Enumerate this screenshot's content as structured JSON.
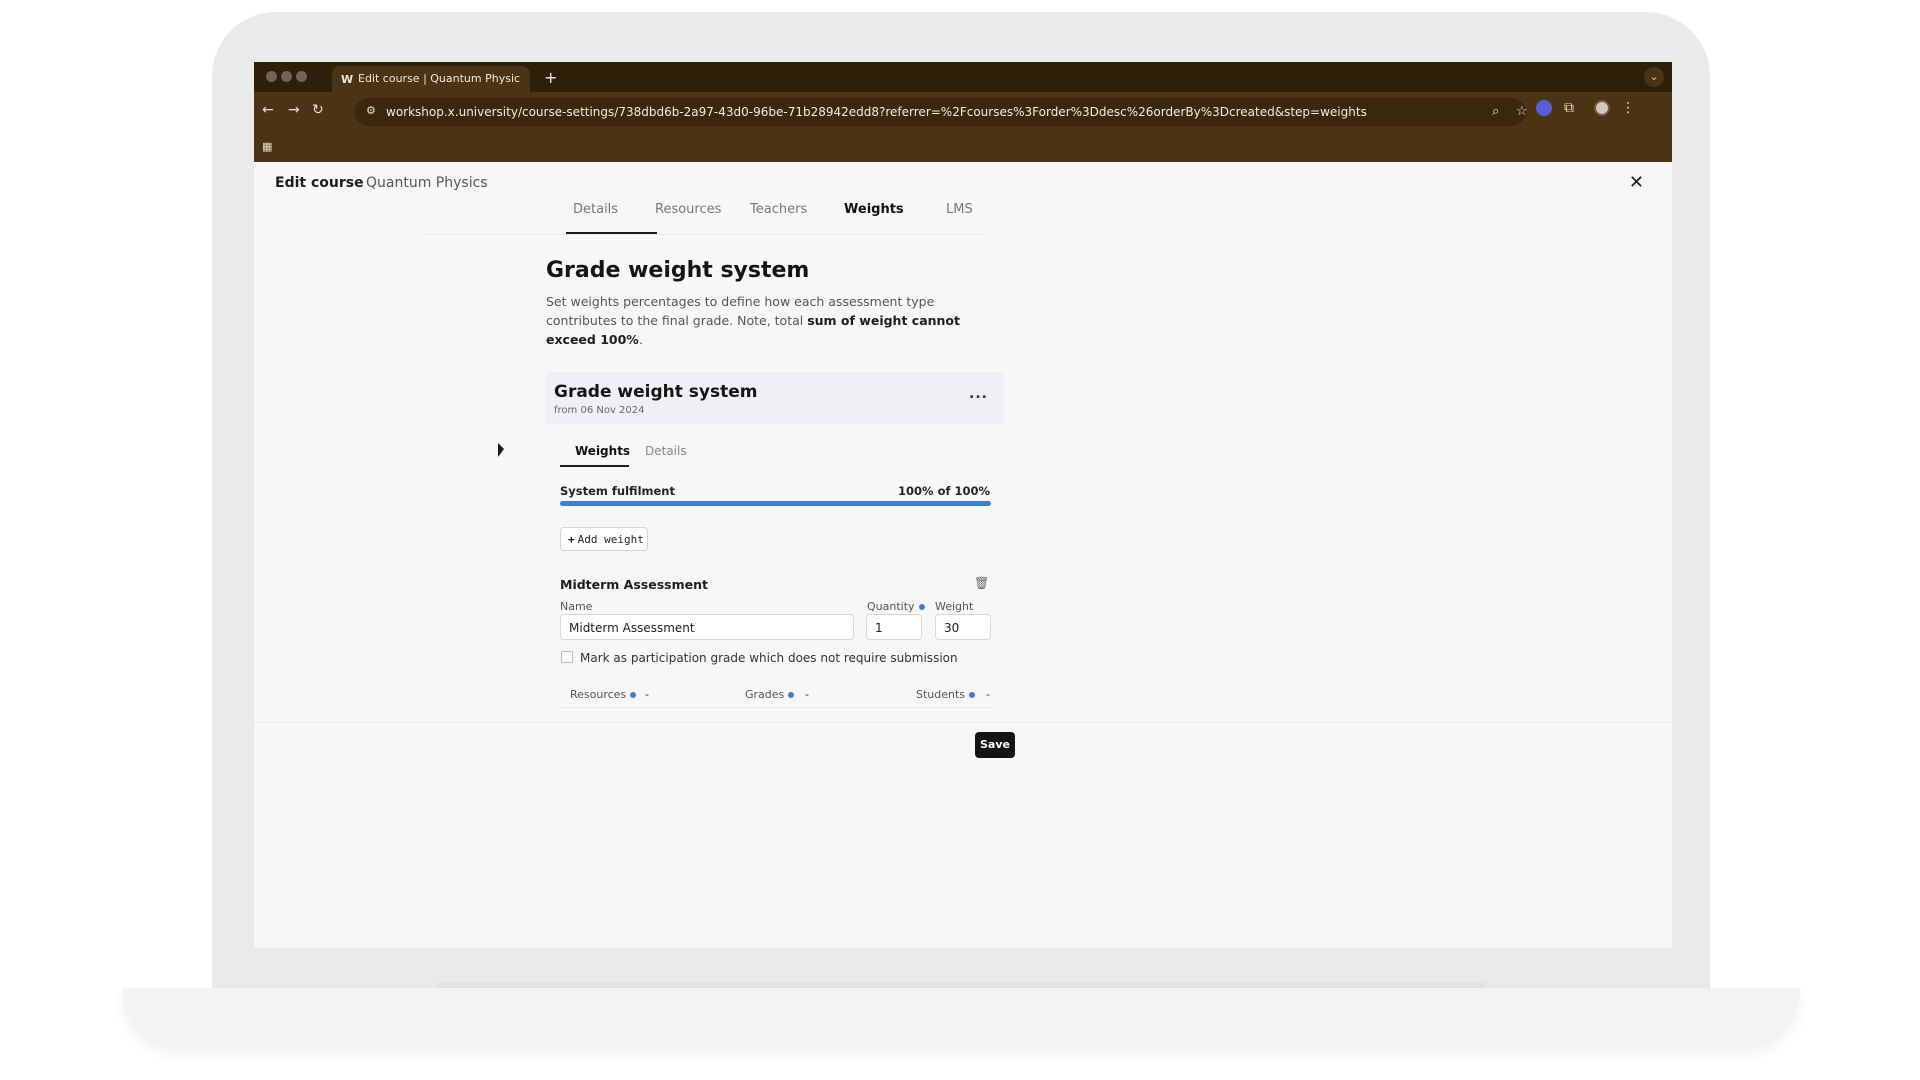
{
  "browser": {
    "tab_title": "Edit course | Quantum Physic",
    "tab_favicon": "W",
    "url": "workshop.x.university/course-settings/738dbd6b-2a97-43d0-96be-71b28942edd8?referrer=%2Fcourses%3Forder%3Ddesc%26orderBy%3Dcreated&step=weights",
    "icons": [
      "back-arrow-icon",
      "forward-arrow-icon",
      "reload-icon",
      "site-settings-icon",
      "zoom-icon",
      "star-icon",
      "extension-icon",
      "puzzle-icon",
      "profile-icon",
      "kebab-menu-icon",
      "apps-grid-icon"
    ]
  },
  "header": {
    "title": "Edit course",
    "course_name": "Quantum Physics"
  },
  "main_tabs": [
    {
      "label": "Details",
      "active": false
    },
    {
      "label": "Resources",
      "active": false
    },
    {
      "label": "Teachers",
      "active": false
    },
    {
      "label": "Weights",
      "active": true
    },
    {
      "label": "LMS",
      "active": false
    }
  ],
  "section": {
    "title": "Grade weight system",
    "description_start": "Set weights percentages to define how each assessment type contributes to the final grade. Note, total ",
    "description_bold": "sum of weight cannot exceed 100%",
    "description_end": "."
  },
  "card": {
    "title": "Grade weight system",
    "subtitle": "from 06 Nov 2024",
    "more_label": "..."
  },
  "sub_tabs": [
    {
      "label": "Weights",
      "active": true
    },
    {
      "label": "Details",
      "active": false
    }
  ],
  "fulfilment": {
    "label": "System fulfilment",
    "value_text": "100% of 100%",
    "fraction": 1.0
  },
  "add_weight_label": "Add weight",
  "assessment": {
    "title": "Midterm Assessment",
    "name_label": "Name",
    "name_value": "Midterm Assessment",
    "quantity_label": "Quantity",
    "quantity_value": "1",
    "weight_label": "Weight",
    "weight_value": "30",
    "checkbox_label": "Mark as participation grade which does not require submission",
    "stats": {
      "resources_label": "Resources",
      "resources_value": "-",
      "grades_label": "Grades",
      "grades_value": "-",
      "students_label": "Students",
      "students_value": "-"
    }
  },
  "save_label": "Save",
  "colors": {
    "chrome": "#4a3413",
    "accent_blue": "#3d7fd4",
    "save_button": "#141414"
  }
}
